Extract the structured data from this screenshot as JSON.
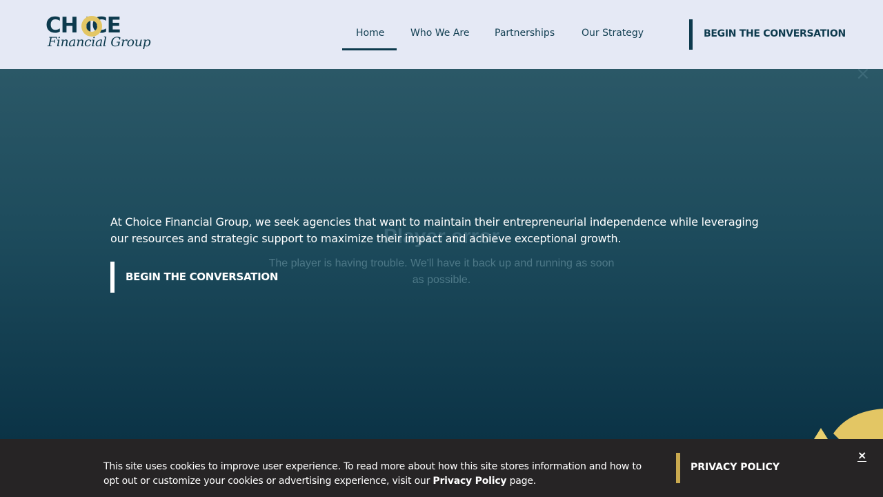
{
  "header": {
    "logo_word": "CH ICE",
    "logo_sub": "Financial Group",
    "nav": [
      {
        "label": "Home",
        "active": true
      },
      {
        "label": "Who We Are"
      },
      {
        "label": "Partnerships"
      },
      {
        "label": "Our Strategy"
      }
    ],
    "cta_label": "BEGIN THE CONVERSATION"
  },
  "hero": {
    "close_symbol": "×",
    "player_title": "Player error",
    "player_message": "The player is having trouble. We'll have it back up and running as soon as possible.",
    "text": "At Choice Financial Group, we seek agencies that want to maintain their entrepreneurial independence while leveraging our resources and strategic support to maximize their impact and achieve exceptional growth.",
    "cta_label": "BEGIN THE CONVERSATION"
  },
  "cookie_bar": {
    "text_before": "This site uses cookies to improve user experience. To read more about how this site stores information and how to opt out or customize your cookies or advertising experience, visit our ",
    "link_label": "Privacy Policy",
    "text_after": " page.",
    "privacy_button": "PRIVACY POLICY",
    "close_symbol": "×"
  },
  "colors": {
    "brand_navy": "#0d3a4d",
    "brand_gold": "#e3c664",
    "cookie_bg": "#262425"
  }
}
